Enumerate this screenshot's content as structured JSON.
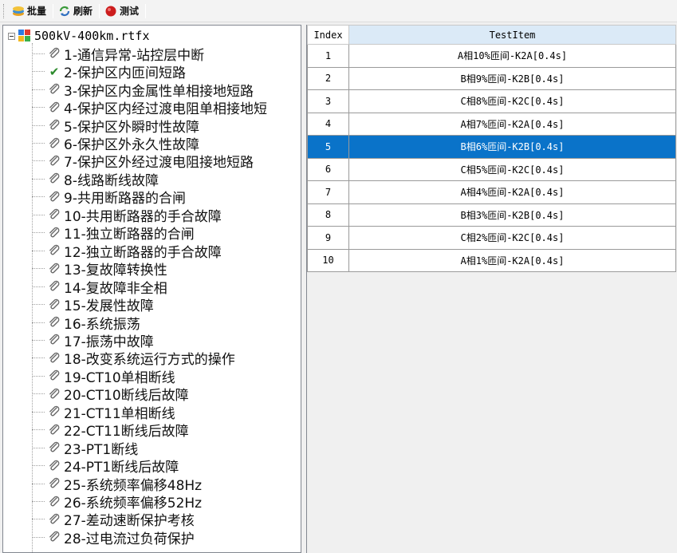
{
  "toolbar": {
    "batch_label": "批量",
    "refresh_label": "刷新",
    "test_label": "测试"
  },
  "tree": {
    "root_label": "500kV-400km.rtfx",
    "items": [
      {
        "label": "1-通信异常-站控层中断",
        "icon": "clip"
      },
      {
        "label": "2-保护区内匝间短路",
        "icon": "check"
      },
      {
        "label": "3-保护区内金属性单相接地短路",
        "icon": "clip"
      },
      {
        "label": "4-保护区内经过渡电阻单相接地短",
        "icon": "clip"
      },
      {
        "label": "5-保护区外瞬时性故障",
        "icon": "clip"
      },
      {
        "label": "6-保护区外永久性故障",
        "icon": "clip"
      },
      {
        "label": "7-保护区外经过渡电阻接地短路",
        "icon": "clip"
      },
      {
        "label": "8-线路断线故障",
        "icon": "clip"
      },
      {
        "label": "9-共用断路器的合闸",
        "icon": "clip"
      },
      {
        "label": "10-共用断路器的手合故障",
        "icon": "clip"
      },
      {
        "label": "11-独立断路器的合闸",
        "icon": "clip"
      },
      {
        "label": "12-独立断路器的手合故障",
        "icon": "clip"
      },
      {
        "label": "13-复故障转换性",
        "icon": "clip"
      },
      {
        "label": "14-复故障非全相",
        "icon": "clip"
      },
      {
        "label": "15-发展性故障",
        "icon": "clip"
      },
      {
        "label": "16-系统振荡",
        "icon": "clip"
      },
      {
        "label": "17-振荡中故障",
        "icon": "clip"
      },
      {
        "label": "18-改变系统运行方式的操作",
        "icon": "clip"
      },
      {
        "label": "19-CT10单相断线",
        "icon": "clip"
      },
      {
        "label": "20-CT10断线后故障",
        "icon": "clip"
      },
      {
        "label": "21-CT11单相断线",
        "icon": "clip"
      },
      {
        "label": "22-CT11断线后故障",
        "icon": "clip"
      },
      {
        "label": "23-PT1断线",
        "icon": "clip"
      },
      {
        "label": "24-PT1断线后故障",
        "icon": "clip"
      },
      {
        "label": "25-系统频率偏移48Hz",
        "icon": "clip"
      },
      {
        "label": "26-系统频率偏移52Hz",
        "icon": "clip"
      },
      {
        "label": "27-差动速断保护考核",
        "icon": "clip"
      },
      {
        "label": "28-过电流过负荷保护",
        "icon": "clip"
      }
    ]
  },
  "table": {
    "columns": [
      "Index",
      "TestItem"
    ],
    "selected_index": "5",
    "rows": [
      {
        "index": "1",
        "item": "A相10%匝间-K2A[0.4s]"
      },
      {
        "index": "2",
        "item": "B相9%匝间-K2B[0.4s]"
      },
      {
        "index": "3",
        "item": "C相8%匝间-K2C[0.4s]"
      },
      {
        "index": "4",
        "item": "A相7%匝间-K2A[0.4s]"
      },
      {
        "index": "5",
        "item": "B相6%匝间-K2B[0.4s]"
      },
      {
        "index": "6",
        "item": "C相5%匝间-K2C[0.4s]"
      },
      {
        "index": "7",
        "item": "A相4%匝间-K2A[0.4s]"
      },
      {
        "index": "8",
        "item": "B相3%匝间-K2B[0.4s]"
      },
      {
        "index": "9",
        "item": "C相2%匝间-K2C[0.4s]"
      },
      {
        "index": "10",
        "item": "A相1%匝间-K2A[0.4s]"
      }
    ]
  },
  "colors": {
    "selection": "#0a73c9",
    "header_highlight": "#dbeaf7"
  }
}
